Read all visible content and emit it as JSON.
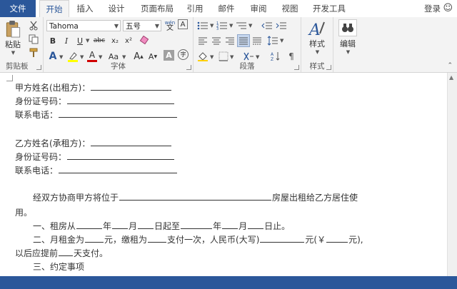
{
  "tabs": [
    "文件",
    "开始",
    "插入",
    "设计",
    "页面布局",
    "引用",
    "邮件",
    "审阅",
    "视图",
    "开发工具"
  ],
  "signin": "登录",
  "clipboard": {
    "paste": "粘贴",
    "label": "剪贴板"
  },
  "font": {
    "name": "Tahoma",
    "size": "五号",
    "wen_icon": "wén",
    "label": "字体",
    "bold": "B",
    "italic": "I",
    "underline": "U",
    "strike": "abc",
    "sub": "x₂",
    "sup": "x²",
    "fontcolor": "A",
    "case": "Aa",
    "grow": "A",
    "shrink": "A",
    "shade": "A",
    "circle": "字"
  },
  "paragraph": {
    "label": "段落"
  },
  "styles": {
    "btn": "样式",
    "label": "样式"
  },
  "editing": {
    "btn": "编辑"
  },
  "doc": {
    "l1_label": "甲方姓名(出租方)：",
    "l2_label": "身份证号码：",
    "l3_label": "联系电话：",
    "l4_label": "乙方姓名(承租方)：",
    "l5_label": "身份证号码：",
    "l6_label": "联系电话：",
    "p1a": "经双方协商甲方将位于",
    "p1b": "房屋出租给乙方居住使",
    "p1c": "用。",
    "p2a": "一、租房从",
    "p2b": "年",
    "p2c": "月",
    "p2d": "日起至",
    "p2e": "年",
    "p2f": "月",
    "p2g": "日止。",
    "p3a": "二、月租金为",
    "p3b": "元，缴租为",
    "p3c": "支付一次，人民币(大写)",
    "p3d": "元(￥",
    "p3e": "元),",
    "p4a": "以后应提前",
    "p4b": "天支付。",
    "p5": "三、约定事项"
  },
  "colors": {
    "accent": "#2b579a",
    "highlight": "#ffff00",
    "fontcolor": "#d00000"
  }
}
